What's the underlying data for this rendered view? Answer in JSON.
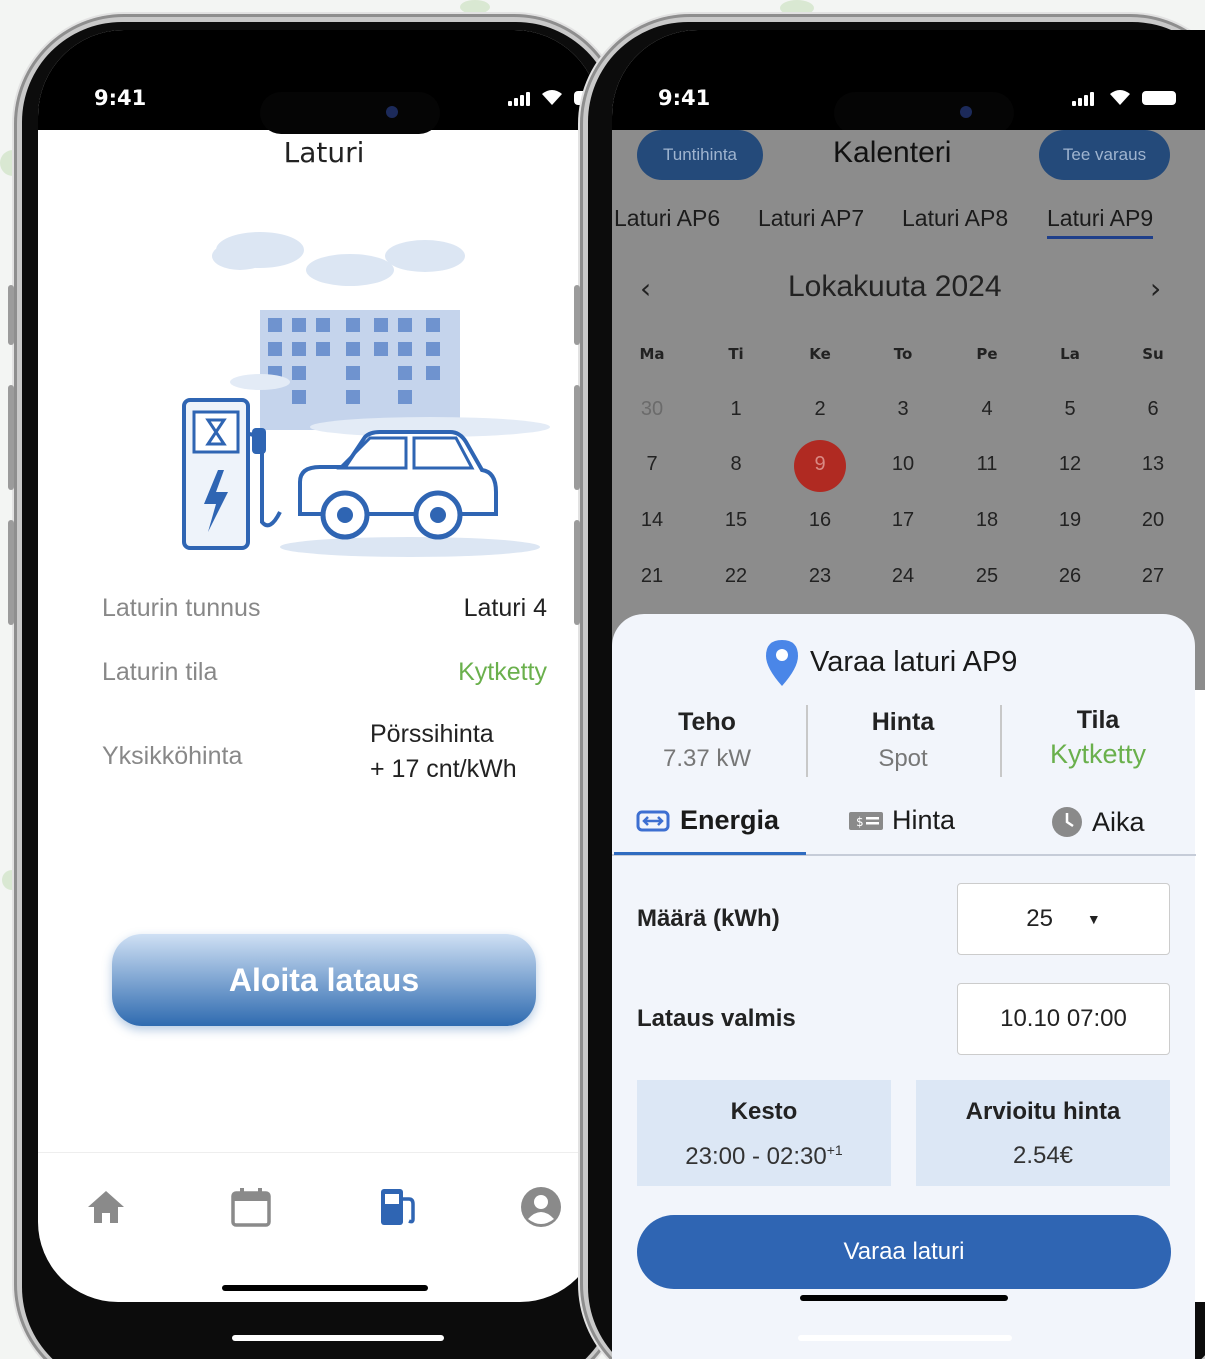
{
  "status_bar": {
    "time_left": "9:41",
    "time_right": "9:41"
  },
  "charger_screen": {
    "title": "Laturi",
    "rows": [
      {
        "label": "Laturin tunnus",
        "value": "Laturi 4"
      },
      {
        "label": "Laturin tila",
        "value": "Kytketty"
      },
      {
        "label": "Yksikköhinta",
        "value_line1": "Pörssihinta",
        "value_line2": "+ 17 cnt/kWh"
      }
    ],
    "start_button": "Aloita lataus",
    "tab_icons": [
      "home-icon",
      "calendar-icon",
      "fuel-station-icon",
      "account-icon"
    ]
  },
  "calendar_screen": {
    "hourly_price_button": "Tuntihinta",
    "title": "Kalenteri",
    "book_button": "Tee varaus",
    "charger_tabs": [
      "Laturi AP6",
      "Laturi AP7",
      "Laturi AP8",
      "Laturi AP9"
    ],
    "active_charger_tab": "Laturi AP9",
    "month_label": "Lokakuuta 2024",
    "weekdays": [
      "Ma",
      "Ti",
      "Ke",
      "To",
      "Pe",
      "La",
      "Su"
    ],
    "weeks": [
      [
        "30",
        "1",
        "2",
        "3",
        "4",
        "5",
        "6"
      ],
      [
        "7",
        "8",
        "9",
        "10",
        "11",
        "12",
        "13"
      ],
      [
        "14",
        "15",
        "16",
        "17",
        "18",
        "19",
        "20"
      ],
      [
        "21",
        "22",
        "23",
        "24",
        "25",
        "26",
        "27"
      ]
    ],
    "selected_day": "9"
  },
  "booking_sheet": {
    "title": "Varaa laturi AP9",
    "stats": [
      {
        "label": "Teho",
        "value": "7.37 kW"
      },
      {
        "label": "Hinta",
        "value": "Spot"
      },
      {
        "label": "Tila",
        "value": "Kytketty"
      }
    ],
    "mode_tabs": [
      "Energia",
      "Hinta",
      "Aika"
    ],
    "active_mode": "Energia",
    "amount_label": "Määrä (kWh)",
    "amount_value": "25",
    "ready_label": "Lataus valmis",
    "ready_value": "10.10 07:00",
    "duration_label": "Kesto",
    "duration_value": "23:00 - 02:30",
    "duration_suffix": "+1",
    "estimate_label": "Arvioitu hinta",
    "estimate_value": "2.54€",
    "submit_button": "Varaa laturi"
  },
  "colors": {
    "accent": "#2f65b3",
    "success": "#6ab04c",
    "today": "#b02a22",
    "dim": "#8c8c8c"
  }
}
